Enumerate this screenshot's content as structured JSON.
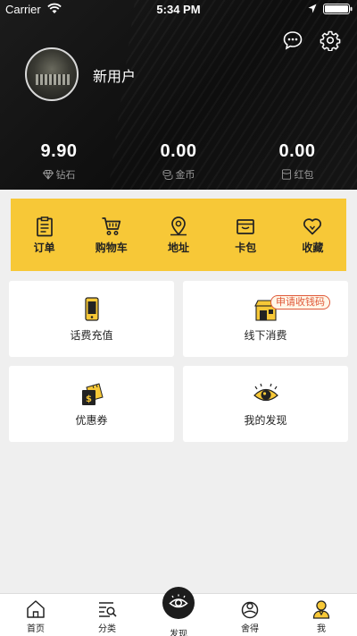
{
  "status": {
    "carrier": "Carrier",
    "time": "5:34 PM"
  },
  "profile": {
    "username": "新用户"
  },
  "stats": [
    {
      "value": "9.90",
      "label": "钻石",
      "icon": "diamond-icon"
    },
    {
      "value": "0.00",
      "label": "金币",
      "icon": "coins-icon"
    },
    {
      "value": "0.00",
      "label": "红包",
      "icon": "red-packet-icon"
    }
  ],
  "menu": [
    {
      "label": "订单",
      "icon": "clipboard-icon"
    },
    {
      "label": "购物车",
      "icon": "cart-icon"
    },
    {
      "label": "地址",
      "icon": "location-pin-icon"
    },
    {
      "label": "卡包",
      "icon": "wallet-icon"
    },
    {
      "label": "收藏",
      "icon": "heart-icon"
    }
  ],
  "cards": {
    "recharge": "话费充值",
    "offline": "线下消费",
    "offline_badge": "申请收钱码",
    "coupon": "优惠券",
    "discover": "我的发现"
  },
  "tabs": [
    {
      "label": "首页",
      "icon": "home-icon"
    },
    {
      "label": "分类",
      "icon": "category-search-icon"
    },
    {
      "label": "发现",
      "icon": "eye-icon"
    },
    {
      "label": "舍得",
      "icon": "sharing-icon"
    },
    {
      "label": "我",
      "icon": "person-icon"
    }
  ],
  "colors": {
    "accent": "#f7c837",
    "header_bg": "#111111",
    "badge": "#e05a3a"
  }
}
